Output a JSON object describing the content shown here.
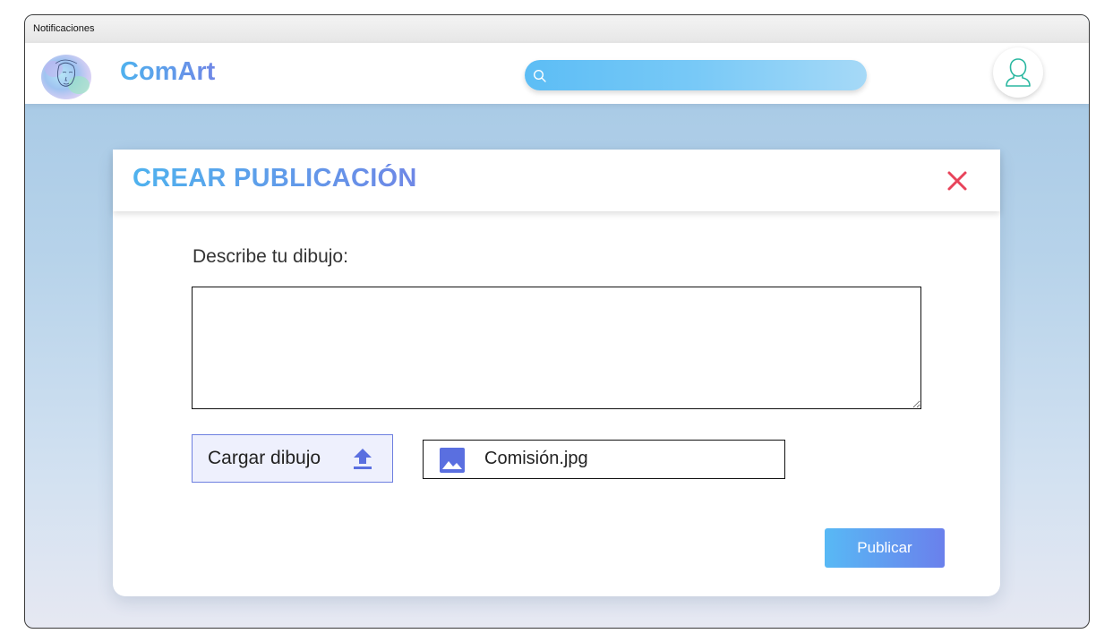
{
  "titlebar": {
    "title": "Notificaciones"
  },
  "header": {
    "brand": "ComArt",
    "search": {
      "placeholder": "",
      "value": ""
    },
    "icons": {
      "search": "search-icon",
      "profile": "user-icon",
      "logo": "watercolor-face-logo"
    }
  },
  "modal": {
    "title": "CREAR PUBLICACIÓN",
    "close_icon": "close-icon",
    "description_label": "Describe tu dibujo:",
    "description_value": "",
    "upload_label": "Cargar dibujo",
    "upload_icon": "upload-icon",
    "file_icon": "image-icon",
    "file_name": "Comisión.jpg",
    "publish_label": "Publicar"
  },
  "colors": {
    "accent": "#4fb2ee",
    "accent_secondary": "#6f87e6",
    "close": "#e8435a",
    "icon_blue": "#5a6fe0",
    "profile_icon": "#2ab7a0"
  }
}
